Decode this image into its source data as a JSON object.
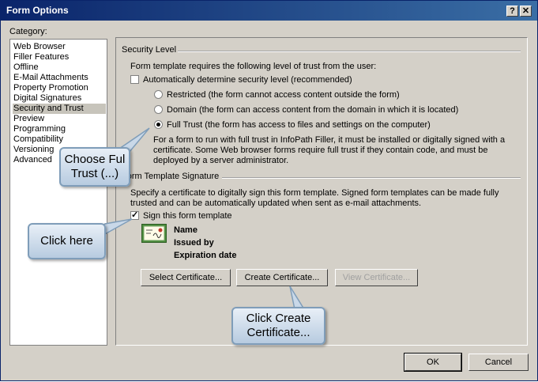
{
  "window": {
    "title": "Form Options",
    "help_label": "?",
    "close_label": "✕"
  },
  "category": {
    "label": "Category:",
    "items": [
      "Web Browser",
      "Filler Features",
      "Offline",
      "E-Mail Attachments",
      "Property Promotion",
      "Digital Signatures",
      "Security and Trust",
      "Preview",
      "Programming",
      "Compatibility",
      "Versioning",
      "Advanced"
    ],
    "selected": "Security and Trust"
  },
  "security_level": {
    "heading": "Security Level",
    "description": "Form template requires the following level of trust from the user:",
    "auto_checkbox_label": "Automatically determine security level (recommended)",
    "restricted_label": "Restricted (the form cannot access content outside the form)",
    "domain_label": "Domain (the form can access content from the domain in which it is located)",
    "full_trust_label": "Full Trust (the form has access to files and settings on the computer)",
    "note_line1": "For a form to run with full trust in InfoPath Filler, it must be installed or digitally signed with a",
    "note_line2": "certificate. Some Web browser forms require full trust if they contain code, and must be",
    "note_line3": "deployed by a server administrator."
  },
  "signature": {
    "heading": "Form Template Signature",
    "description_line1": "Specify a certificate to digitally sign this form template. Signed form templates can be made fully",
    "description_line2": "trusted and can be automatically updated when sent as e-mail attachments.",
    "sign_checkbox_label": "Sign this form template",
    "name_label": "Name",
    "issued_label": "Issued by",
    "expiration_label": "Expiration date",
    "select_button": "Select Certificate...",
    "create_button": "Create Certificate...",
    "view_button": "View Certificate..."
  },
  "footer": {
    "ok_label": "OK",
    "cancel_label": "Cancel"
  },
  "callouts": {
    "choose_line1": "Choose Ful",
    "choose_line2": "Trust (...)",
    "click_here": "Click here",
    "create_line1": "Click Create",
    "create_line2": "Certificate..."
  }
}
